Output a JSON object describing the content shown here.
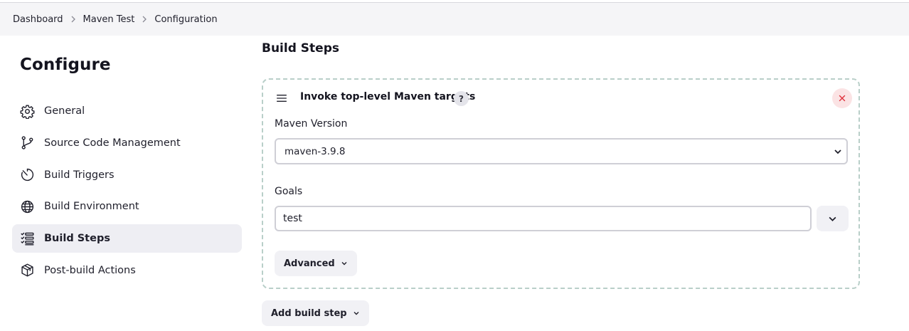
{
  "breadcrumb": {
    "items": [
      {
        "label": "Dashboard"
      },
      {
        "label": "Maven Test"
      },
      {
        "label": "Configuration"
      }
    ],
    "separator_icon": "chevron-right-icon"
  },
  "page": {
    "title": "Configure"
  },
  "sidebar": {
    "items": [
      {
        "label": "General",
        "icon": "gear-icon",
        "active": false
      },
      {
        "label": "Source Code Management",
        "icon": "branch-icon",
        "active": false
      },
      {
        "label": "Build Triggers",
        "icon": "timer-icon",
        "active": false
      },
      {
        "label": "Build Environment",
        "icon": "globe-icon",
        "active": false
      },
      {
        "label": "Build Steps",
        "icon": "list-icon",
        "active": true
      },
      {
        "label": "Post-build Actions",
        "icon": "package-icon",
        "active": false
      }
    ]
  },
  "main": {
    "section_title": "Build Steps",
    "step": {
      "title": "Invoke top-level Maven targets",
      "help_label": "?",
      "maven_version_label": "Maven Version",
      "maven_version_value": "maven-3.9.8",
      "goals_label": "Goals",
      "goals_value": "test",
      "advanced_label": "Advanced"
    },
    "add_step_label": "Add build step"
  },
  "colors": {
    "breadcrumb_bg": "#f5f5f7",
    "active_nav_bg": "#eeeef3",
    "card_border": "#b9cfc9",
    "close_bg": "#fbe3e4",
    "close_icon": "#e0323c"
  }
}
